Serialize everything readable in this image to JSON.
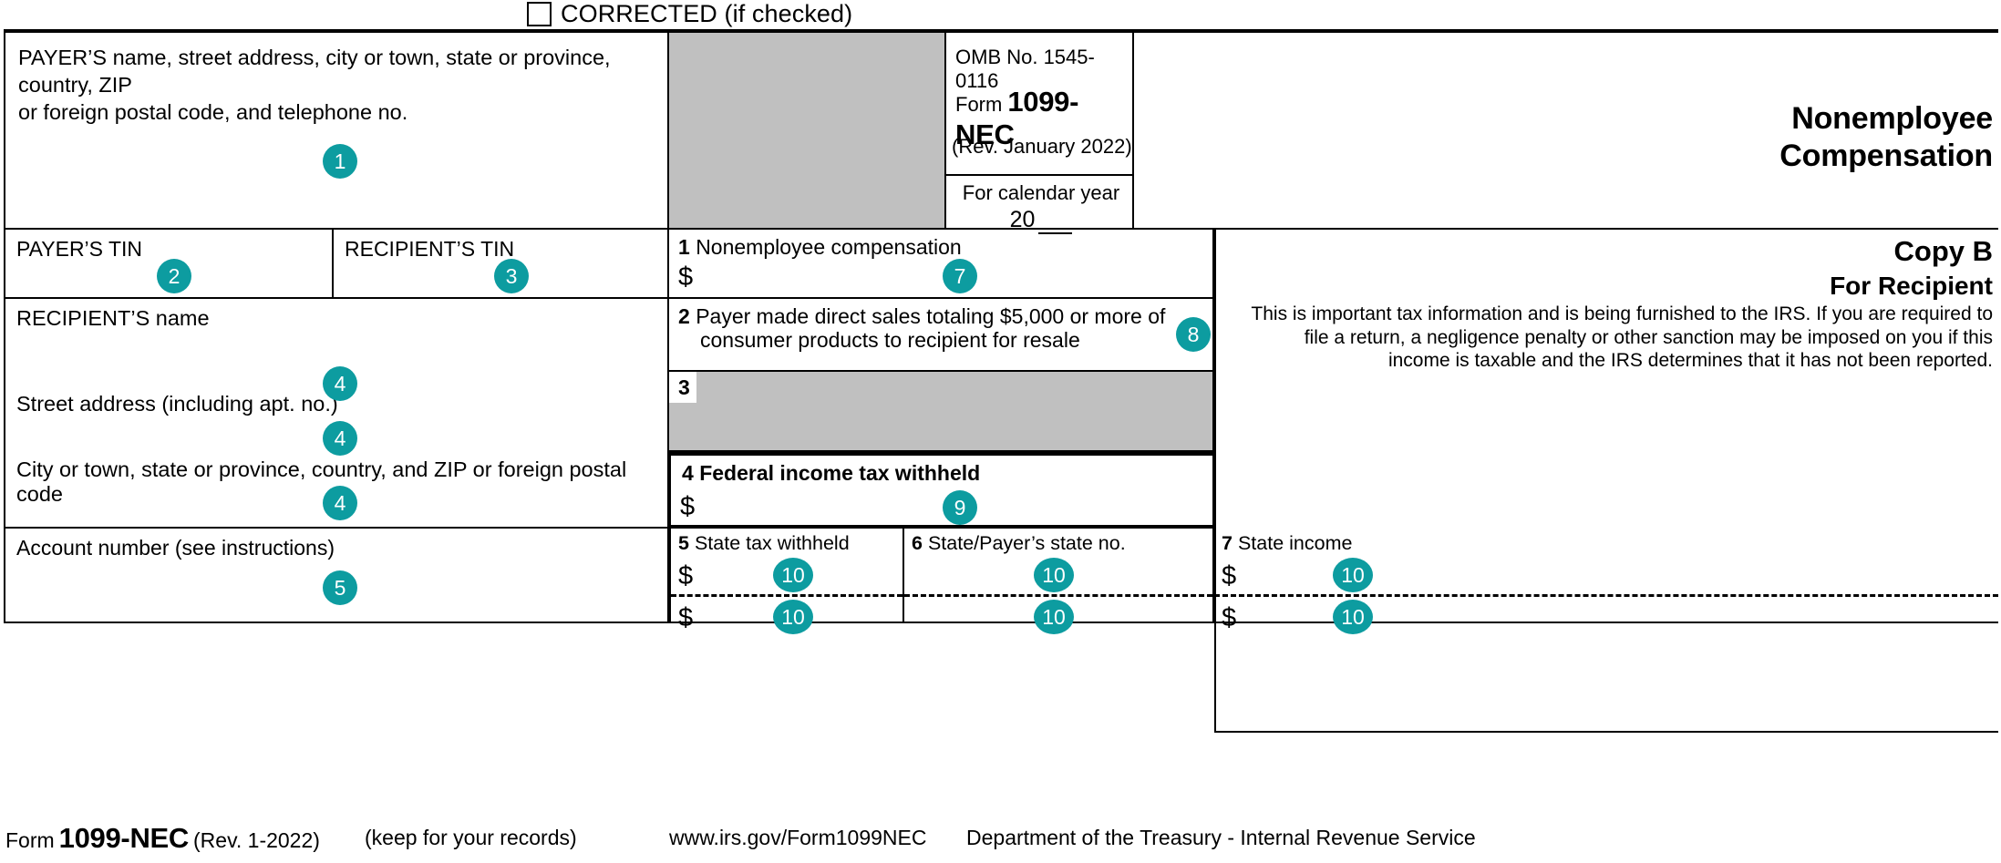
{
  "header": {
    "corrected_label": "CORRECTED (if checked)",
    "corrected_checked": false
  },
  "payer_block": {
    "label_line1": "PAYER’S name, street address, city or town, state or province, country, ZIP",
    "label_line2": "or foreign postal code, and telephone no.",
    "marker": "1"
  },
  "omb_block": {
    "omb_no": "OMB No. 1545-0116",
    "form_word": "Form",
    "form_number": "1099-NEC",
    "revision": "(Rev. January 2022)"
  },
  "calendar_block": {
    "label": "For calendar year",
    "year_prefix": "20"
  },
  "title_block": {
    "line1": "Nonemployee",
    "line2": "Compensation"
  },
  "tin_row": {
    "payer_tin_label": "PAYER’S TIN",
    "payer_tin_marker": "2",
    "recipient_tin_label": "RECIPIENT’S TIN",
    "recipient_tin_marker": "3"
  },
  "recipient_block": {
    "name_label": "RECIPIENT’S name",
    "name_marker": "4",
    "street_label": "Street address (including apt. no.)",
    "street_marker": "4",
    "city_label": "City or town, state or province, country, and ZIP or foreign postal code",
    "city_marker": "4",
    "account_label": "Account number (see instructions)",
    "account_marker": "5"
  },
  "boxes": {
    "box1": {
      "number": "1",
      "label": "Nonemployee compensation",
      "currency": "$",
      "marker": "7"
    },
    "box2": {
      "number": "2",
      "label_line1": "Payer made direct sales totaling $5,000 or more of",
      "label_line2": "consumer products to recipient for resale",
      "marker": "8"
    },
    "box3": {
      "number": "3"
    },
    "box4": {
      "number": "4",
      "label": "Federal income tax withheld",
      "currency": "$",
      "marker": "9"
    },
    "box5": {
      "number": "5",
      "label": "State tax withheld",
      "currency_top": "$",
      "currency_bottom": "$",
      "marker_top": "10",
      "marker_bottom": "10"
    },
    "box6": {
      "number": "6",
      "label": "State/Payer’s state no.",
      "marker_top": "10",
      "marker_bottom": "10"
    },
    "box7": {
      "number": "7",
      "label": "State income",
      "currency_top": "$",
      "currency_bottom": "$",
      "marker_top": "10",
      "marker_bottom": "10"
    }
  },
  "copy_b": {
    "title": "Copy B",
    "subtitle": "For Recipient",
    "body": "This is important tax information and is being furnished to the IRS. If you are required to file a return, a negligence penalty or other sanction may be imposed on you if this income is taxable and the IRS determines that it has not been reported."
  },
  "footer": {
    "form_word": "Form",
    "form_number": "1099-NEC",
    "revision": "(Rev. 1-2022)",
    "keep": "(keep for your records)",
    "url": "www.irs.gov/Form1099NEC",
    "department": "Department of the Treasury - Internal Revenue Service"
  },
  "colors": {
    "marker_teal": "#0d9ca0",
    "shaded_box": "#c0c0c0",
    "rule": "#000000"
  }
}
